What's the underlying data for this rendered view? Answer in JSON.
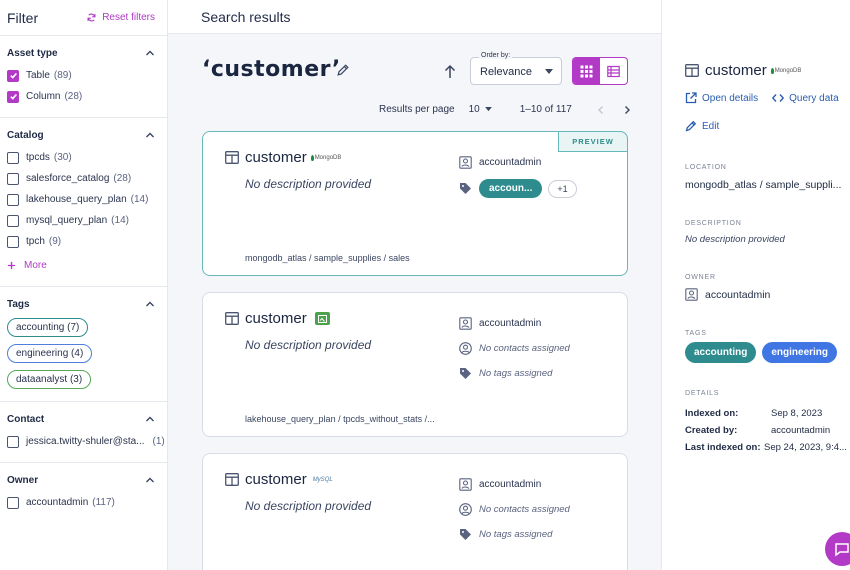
{
  "sidebar": {
    "title": "Filter",
    "reset_label": "Reset filters",
    "asset_type": {
      "title": "Asset type",
      "items": [
        {
          "label": "Table",
          "count": "(89)",
          "checked": true
        },
        {
          "label": "Column",
          "count": "(28)",
          "checked": true
        }
      ]
    },
    "catalog": {
      "title": "Catalog",
      "items": [
        {
          "label": "tpcds",
          "count": "(30)"
        },
        {
          "label": "salesforce_catalog",
          "count": "(28)"
        },
        {
          "label": "lakehouse_query_plan",
          "count": "(14)"
        },
        {
          "label": "mysql_query_plan",
          "count": "(14)"
        },
        {
          "label": "tpch",
          "count": "(9)"
        }
      ],
      "more_label": "More"
    },
    "tags": {
      "title": "Tags",
      "items": [
        {
          "label": "accounting",
          "count": "(7)"
        },
        {
          "label": "engineering",
          "count": "(4)"
        },
        {
          "label": "dataanalyst",
          "count": "(3)"
        }
      ]
    },
    "contact": {
      "title": "Contact",
      "items": [
        {
          "label": "jessica.twitty-shuler@sta...",
          "count": "(1)"
        }
      ]
    },
    "owner": {
      "title": "Owner",
      "items": [
        {
          "label": "accountadmin",
          "count": "(117)"
        }
      ]
    }
  },
  "main": {
    "header": "Search results",
    "query": "‘customer’",
    "order_by_label": "Order by:",
    "order_by_value": "Relevance",
    "results_per_page_label": "Results per page",
    "results_per_page_value": "10",
    "range": "1–10 of 117",
    "cards": [
      {
        "title": "customer",
        "logo_text": "MongoDB",
        "description": "No description provided",
        "owner": "accountadmin",
        "tag": "accoun...",
        "tag_more": "+1",
        "path": "mongodb_atlas / sample_supplies / sales",
        "badge": "PREVIEW"
      },
      {
        "title": "customer",
        "description": "No description provided",
        "owner": "accountadmin",
        "contacts": "No contacts assigned",
        "tags": "No tags assigned",
        "path": "lakehouse_query_plan / tpcds_without_stats /..."
      },
      {
        "title": "customer",
        "logo_text": "MySQL",
        "description": "No description provided",
        "owner": "accountadmin",
        "contacts": "No contacts assigned",
        "tags": "No tags assigned"
      }
    ]
  },
  "detail": {
    "title": "customer",
    "logo_text": "MongoDB",
    "open_details": "Open details",
    "query_data": "Query data",
    "edit": "Edit",
    "location_label": "LOCATION",
    "location": "mongodb_atlas / sample_suppli...",
    "description_label": "DESCRIPTION",
    "description": "No description provided",
    "owner_label": "OWNER",
    "owner": "accountadmin",
    "tags_label": "TAGS",
    "tags": [
      "accounting",
      "engineering"
    ],
    "details_label": "DETAILS",
    "indexed_on_k": "Indexed on:",
    "indexed_on_v": "Sep 8, 2023",
    "created_by_k": "Created by:",
    "created_by_v": "accountadmin",
    "last_indexed_k": "Last indexed on:",
    "last_indexed_v": "Sep 24, 2023, 9:4..."
  },
  "colors": {
    "accent": "#b23ac6",
    "teal": "#2e8c8e",
    "blue": "#3f76e4",
    "link": "#2a5db0"
  },
  "icons": [
    "refresh-icon",
    "chevron-up-icon",
    "check-icon",
    "plus-icon",
    "pencil-icon",
    "arrow-up-icon",
    "caret-down-icon",
    "grid-icon",
    "list-icon",
    "chevron-left-icon",
    "chevron-right-icon",
    "table-icon",
    "user-badge-icon",
    "tag-icon",
    "contact-icon",
    "external-link-icon",
    "code-icon",
    "chat-icon"
  ]
}
